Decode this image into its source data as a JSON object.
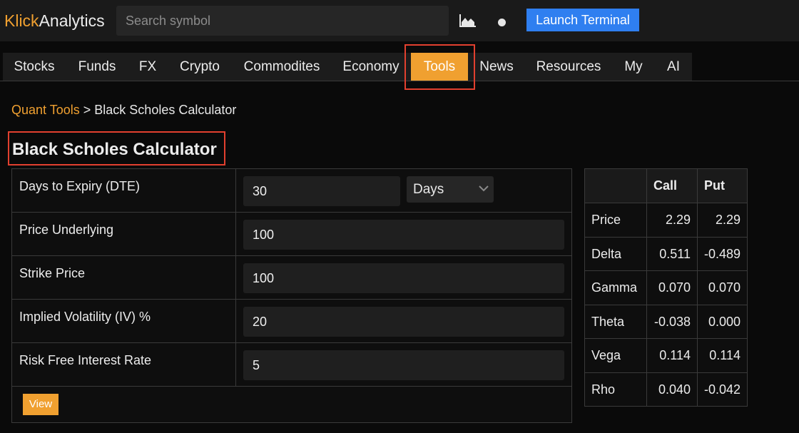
{
  "header": {
    "logo_part1": "Klick",
    "logo_part2": "Analytics",
    "search_placeholder": "Search symbol",
    "chart_icon": "area-chart-icon",
    "theme_icon": "theme-toggle-dot",
    "launch_label": "Launch Terminal"
  },
  "nav": {
    "items": [
      "Stocks",
      "Funds",
      "FX",
      "Crypto",
      "Commodites",
      "Economy",
      "Tools",
      "News",
      "Resources",
      "My",
      "AI"
    ],
    "active": "Tools"
  },
  "breadcrumb": {
    "parent": "Quant Tools",
    "separator": ">",
    "current": "Black Scholes Calculator"
  },
  "page_title": "Black Scholes Calculator",
  "form": {
    "dte_label": "Days to Expiry (DTE)",
    "dte_value": "30",
    "dte_unit": "Days",
    "price_label": "Price Underlying",
    "price_value": "100",
    "strike_label": "Strike Price",
    "strike_value": "100",
    "iv_label": "Implied Volatility (IV) %",
    "iv_value": "20",
    "rate_label": "Risk Free Interest Rate",
    "rate_value": "5",
    "view_label": "View"
  },
  "results": {
    "headers": [
      "",
      "Call",
      "Put"
    ],
    "rows": [
      {
        "name": "Price",
        "call": "2.29",
        "put": "2.29"
      },
      {
        "name": "Delta",
        "call": "0.511",
        "put": "-0.489"
      },
      {
        "name": "Gamma",
        "call": "0.070",
        "put": "0.070"
      },
      {
        "name": "Theta",
        "call": "-0.038",
        "put": "0.000"
      },
      {
        "name": "Vega",
        "call": "0.114",
        "put": "0.114"
      },
      {
        "name": "Rho",
        "call": "0.040",
        "put": "-0.042"
      }
    ]
  },
  "colors": {
    "accent": "#f0a030",
    "button_blue": "#2f7ff0",
    "highlight_red": "#e2402f"
  }
}
